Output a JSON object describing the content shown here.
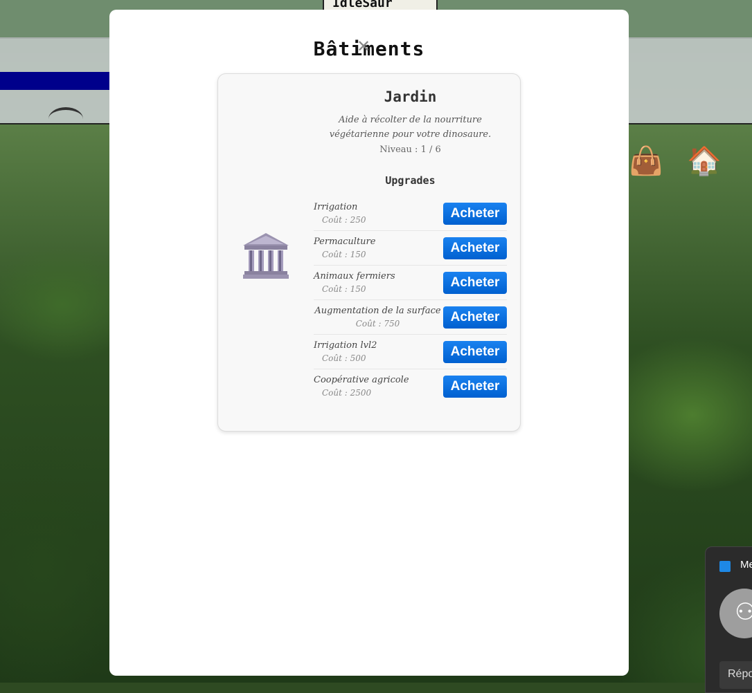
{
  "background": {
    "tab_label": "IdleSaur",
    "notification": {
      "title": "Me",
      "reply_label": "Répo"
    }
  },
  "modal": {
    "title": "Bâtiments",
    "building": {
      "name": "Jardin",
      "description": "Aide à récolter de la nourriture végétarienne pour votre dinosaure.",
      "level": "Niveau : 1 / 6",
      "upgrades_title": "Upgrades",
      "upgrades": [
        {
          "name": "Irrigation",
          "cost": "Coût : 250",
          "button": "Acheter"
        },
        {
          "name": "Permaculture",
          "cost": "Coût : 150",
          "button": "Acheter"
        },
        {
          "name": "Animaux fermiers",
          "cost": "Coût : 150",
          "button": "Acheter"
        },
        {
          "name": "Augmentation de la surface",
          "cost": "Coût : 750",
          "button": "Acheter"
        },
        {
          "name": "Irrigation lvl2",
          "cost": "Coût : 500",
          "button": "Acheter"
        },
        {
          "name": "Coopérative agricole",
          "cost": "Coût : 2500",
          "button": "Acheter"
        }
      ]
    }
  },
  "colors": {
    "button": "#0a6fe6",
    "accent_blue": "#00008b"
  }
}
